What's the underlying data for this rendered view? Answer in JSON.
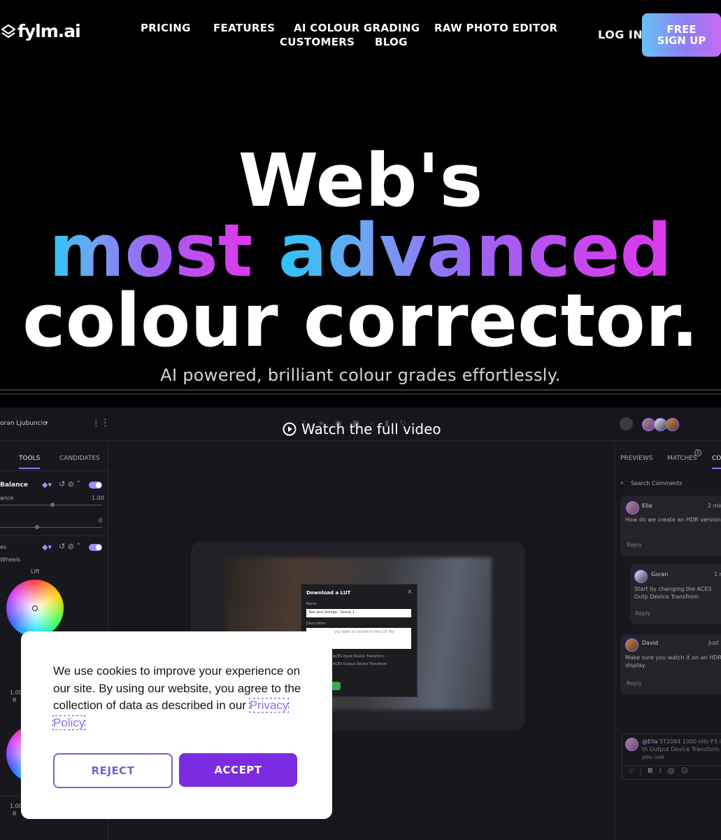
{
  "nav": {
    "logo": "fylm.ai",
    "links": [
      "PRICING",
      "FEATURES",
      "AI COLOUR GRADING",
      "RAW PHOTO EDITOR",
      "CUSTOMERS",
      "BLOG"
    ],
    "login": "LOG IN",
    "signup_line1": "FREE",
    "signup_line2": "SIGN UP"
  },
  "hero": {
    "line1": "Web's",
    "line2a": "most",
    "line2b": "advanced",
    "line3": "colour corrector.",
    "subtitle": "AI powered, brilliant colour grades effortlessly."
  },
  "app": {
    "user": "oran Ljubuncic",
    "watch_label": "Watch the full video",
    "left_tabs": [
      "TOOLS",
      "CANDIDATES"
    ],
    "balance_label": "Balance",
    "balance_sub": "ance",
    "balance_value": "1.00",
    "zero_value": "0",
    "curves_label": "es",
    "wheels_label": "Wheels",
    "lift_label": "Lift",
    "value_a": "1.00",
    "value_r": "R",
    "value_b": "1.00",
    "value_r2": "R",
    "right_tabs": [
      "PREVIEWS",
      "MATCHES",
      "CO"
    ],
    "matches_count": "2",
    "search_placeholder": "Search Comments",
    "comments": [
      {
        "name": "Ella",
        "time": "2 min",
        "text": "How do we create an HDR version?",
        "reply": "Reply"
      },
      {
        "name": "Goran",
        "time": "1 m",
        "text": "Start by changing the ACES Outp Device Transfrom.",
        "reply": "Reply"
      },
      {
        "name": "David",
        "time": "Just",
        "text": "Make sure you watch it on an HDR display.",
        "reply": "Reply"
      }
    ],
    "compose_mention": "@Ella",
    "compose_text": "ST2084 1000 nits P3 is th Output Device Transform you use",
    "dialog": {
      "title": "Download a LUT",
      "name_label": "Name",
      "name_value": "Teal and Orange - Scene 1",
      "desc_label": "Description",
      "desc_placeholder": "you want to include in the LUT file",
      "opt1": "ACES Input Device Transform",
      "opt2": "ACES Output Device Transform"
    }
  },
  "cookie": {
    "text": "We use cookies to improve your experience on our site. By using our website, you agree to the collection of data as described in our",
    "link": "Privacy Policy",
    "reject": "REJECT",
    "accept": "ACCEPT"
  }
}
